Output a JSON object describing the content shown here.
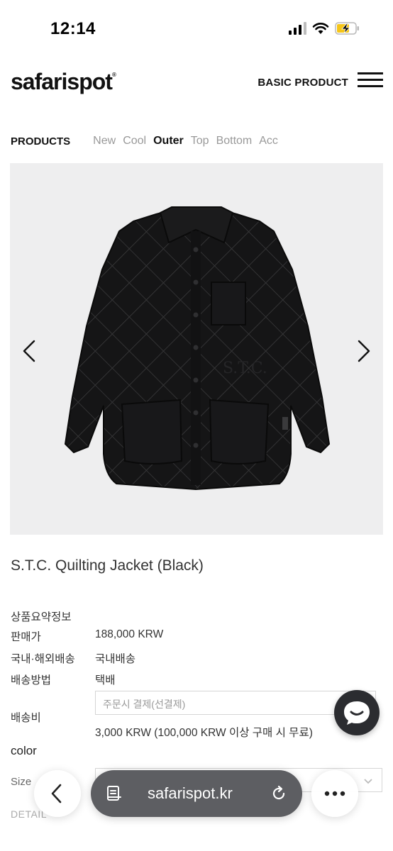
{
  "status_bar": {
    "time": "12:14",
    "icons": [
      "cellular-signal-icon",
      "wifi-icon",
      "battery-charging-icon"
    ],
    "battery_color": "#f5c518"
  },
  "header": {
    "logo": "safarispot",
    "logo_mark": "®",
    "basic_product": "BASIC PRODUCT",
    "menu_icon": "hamburger-menu-icon"
  },
  "category_nav": {
    "title": "PRODUCTS",
    "items": [
      {
        "label": "New",
        "active": false
      },
      {
        "label": "Cool",
        "active": false
      },
      {
        "label": "Outer",
        "active": true
      },
      {
        "label": "Top",
        "active": false
      },
      {
        "label": "Bottom",
        "active": false
      },
      {
        "label": "Acc",
        "active": false
      }
    ]
  },
  "product": {
    "image": "black-quilted-jacket-photo",
    "jacket_logo_text": "S.T.C.",
    "title": "S.T.C. Quilting Jacket (Black)",
    "info": {
      "summary_label": "상품요약정보",
      "price_label": "판매가",
      "price_value": "188,000 KRW",
      "shipping_type_label": "국내·해외배송",
      "shipping_type_value": "국내배송",
      "shipping_method_label": "배송방법",
      "shipping_method_value": "택배",
      "shipping_fee_label": "배송비",
      "shipping_fee_select": "주문시 결제(선결제)",
      "shipping_fee_value": "3,000 KRW (100,000 KRW 이상 구매 시 무료)"
    },
    "color_label": "color",
    "size_label": "Size",
    "detail_label": "DETAIL"
  },
  "chat_button": {
    "icon": "chat-bubble-icon"
  },
  "browser": {
    "url": "safarispot.kr",
    "back_icon": "chevron-left-icon",
    "tabs_icon": "page-menu-icon",
    "reload_icon": "reload-icon",
    "more_icon": "more-dots-icon"
  }
}
